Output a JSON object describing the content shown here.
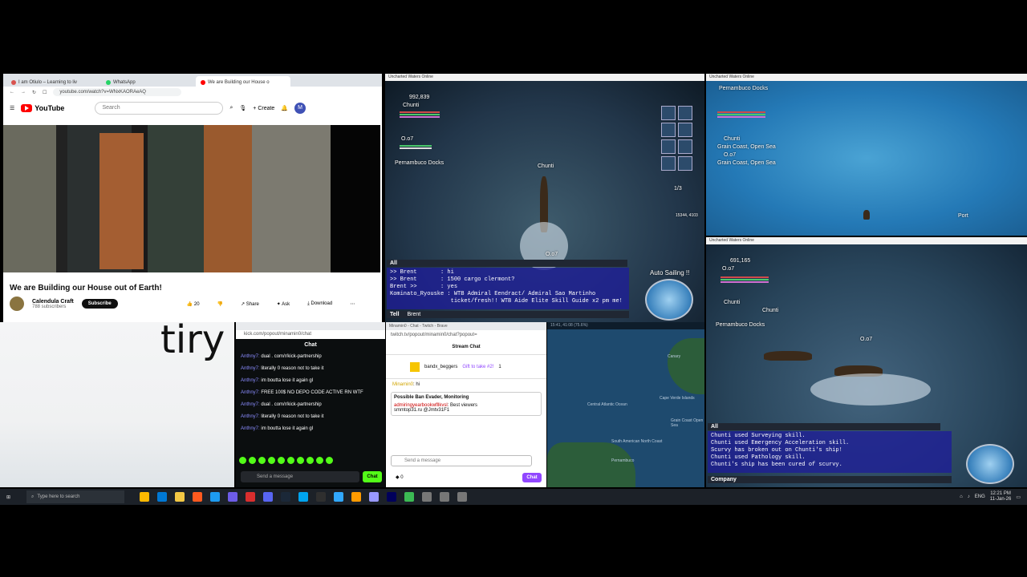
{
  "browser": {
    "tabs": [
      {
        "label": "I am Otiulo – Learning to liv",
        "color": "#d9534f"
      },
      {
        "label": "WhatsApp",
        "color": "#25d366"
      },
      {
        "label": "We are Building our House o",
        "color": "#ff0000"
      }
    ],
    "url": "youtube.com/watch?v=WNxKAORAeAQ",
    "youtube": {
      "logo": "YouTube",
      "search_placeholder": "Search",
      "create_label": "Create",
      "avatar_letter": "M",
      "video_title": "We are Building our House out of Earth!",
      "channel": "Calendula Craft",
      "subscribers": "788 subscribers",
      "subscribe_label": "Subscribe",
      "likes": "20",
      "share_label": "Share",
      "ask_label": "Ask",
      "download_label": "Download"
    }
  },
  "canvas_text": "tiry",
  "kick": {
    "url": "kick.com/popout/minamin0/chat",
    "header": "Chat",
    "messages": [
      {
        "user": "Anthny7:",
        "text": "dual . com/r/kick-partnership"
      },
      {
        "user": "Anthny7:",
        "text": "literally 0 reason not to take it"
      },
      {
        "user": "Anthny7:",
        "text": "im boutta lose it again gl"
      },
      {
        "user": "Anthny7:",
        "text": "FREE 100$ NO DEPO CODE ACTIVE RN WTF"
      },
      {
        "user": "Anthny7:",
        "text": "dual . com/r/kick-partnership"
      },
      {
        "user": "Anthny7:",
        "text": "literally 0 reason not to take it"
      },
      {
        "user": "Anthny7:",
        "text": "im boutta lose it again gl"
      }
    ],
    "send_placeholder": "Send a message",
    "chat_button": "Chat"
  },
  "twitch": {
    "title": "Minamin0 - Chat - Twitch - Brave",
    "url": "twitch.tv/popout/minamin0/chat?popout=",
    "header": "Stream Chat",
    "gift_user": "bandx_beggers",
    "gift_text": "Gift to take #2!",
    "gift_count": "1",
    "line1_user": "Minamin0",
    "line1_text": ": hi",
    "ban_title": "Possible Ban Evader, Monitoring",
    "ban_user": "admiringyearbookwfllkvsl",
    "ban_text": ": Best viewers",
    "ban_text2": "smmtop31.ru @Jmtv31F1",
    "send_placeholder": "Send a message",
    "points": "0",
    "chat_button": "Chat"
  },
  "map": {
    "title": "15:41, 41:08 (75.6%)",
    "labels": [
      "Central Atlantic Ocean",
      "Cape Verde Islands",
      "South American North Coast",
      "Grain Coast Open Sea",
      "Canary",
      "Pernambuco"
    ]
  },
  "game1": {
    "title": "Uncharted Waters Online",
    "gold": "992,839",
    "ally": "Chunti",
    "self": "O.o7",
    "location": "Pernambuco Docks",
    "ship_label1": "Chunti",
    "ship_label2": "O.o7",
    "page_indicator": "1/3",
    "coords": "15344, 4103",
    "auto_sailing": "Auto Sailing !!",
    "chat_tab": "All",
    "chat_lines": [
      ">> Brent       : hi",
      ">> Brent       : 1500 cargo clermont?",
      "Brent >>       : yes",
      "Kominato_Ryouske : WTB Admiral Eendract/ Admiral Sao Martinho",
      "                  ticket/fresh!! WTB Aide Elite Skill Guide x2 pm me!"
    ],
    "tell_label": "Tell",
    "tell_target": "Brent"
  },
  "game2": {
    "title": "Uncharted Waters Online",
    "location": "Pernambuco Docks",
    "ally": "Chunti",
    "self": "O.o7",
    "area1": "Grain Coast, Open Sea",
    "area2": "Grain Coast, Open Sea",
    "port_label": "Port"
  },
  "game3": {
    "title": "Uncharted Waters Online",
    "gold": "691,165",
    "self": "O.o7",
    "ally": "Chunti",
    "location": "Pernambuco Docks",
    "ship_label1": "Chunti",
    "ship_label2": "O.o7",
    "chat_tab": "All",
    "chat_lines": [
      "Chunti used Surveying skill.",
      "Chunti used Emergency Acceleration skill.",
      "Scurvy has broken out on Chunti's ship!",
      "Chunti used Pathology skill.",
      "Chunti's ship has been cured of scurvy."
    ],
    "company_label": "Company"
  },
  "taskbar": {
    "search_placeholder": "Type here to search",
    "apps": [
      "#ffb900",
      "#0078d4",
      "#f2c744",
      "#ff5a1f",
      "#1d9bf0",
      "#6d5ce7",
      "#d92e2e",
      "#5865f2",
      "#1b2838",
      "#00a4ef",
      "#2f2f2f",
      "#31a8ff",
      "#ff9a00",
      "#9999ff",
      "#00005b",
      "#3cba54",
      "#777777",
      "#777777",
      "#777777"
    ],
    "lang": "ENG",
    "time": "12:21 PM",
    "date": "11-Jan-26"
  },
  "colors": {
    "accent_youtube": "#ff0000",
    "accent_kick": "#53fc18",
    "accent_twitch": "#9147ff"
  }
}
